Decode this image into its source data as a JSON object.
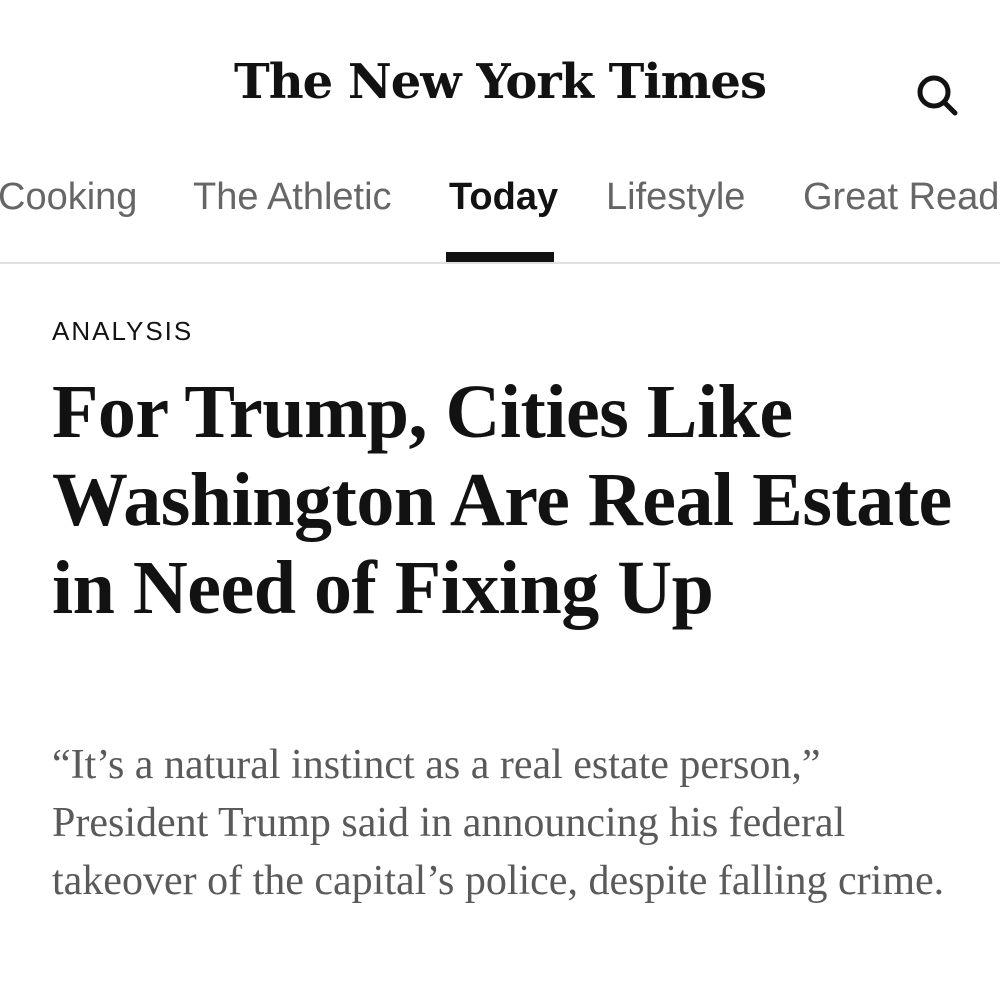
{
  "masthead": {
    "logo_text": "The New York Times"
  },
  "icons": {
    "search": "search-icon"
  },
  "nav": {
    "items": [
      {
        "label": "Cooking"
      },
      {
        "label": "The Athletic"
      },
      {
        "label": "Today"
      },
      {
        "label": "Lifestyle"
      },
      {
        "label": "Great Reads"
      }
    ],
    "active": "Today"
  },
  "article": {
    "kicker": "ANALYSIS",
    "headline": "For Trump, Cities Like Washington Are Real Estate in Need of Fixing Up",
    "summary": "“It’s a natural instinct as a real estate person,” President Trump said in announcing his federal takeover of the capital’s police, despite falling crime."
  },
  "colors": {
    "text_primary": "#121212",
    "text_secondary": "#666666",
    "summary_text": "#5a5a5a",
    "divider": "#dfdfdf",
    "background": "#ffffff"
  }
}
